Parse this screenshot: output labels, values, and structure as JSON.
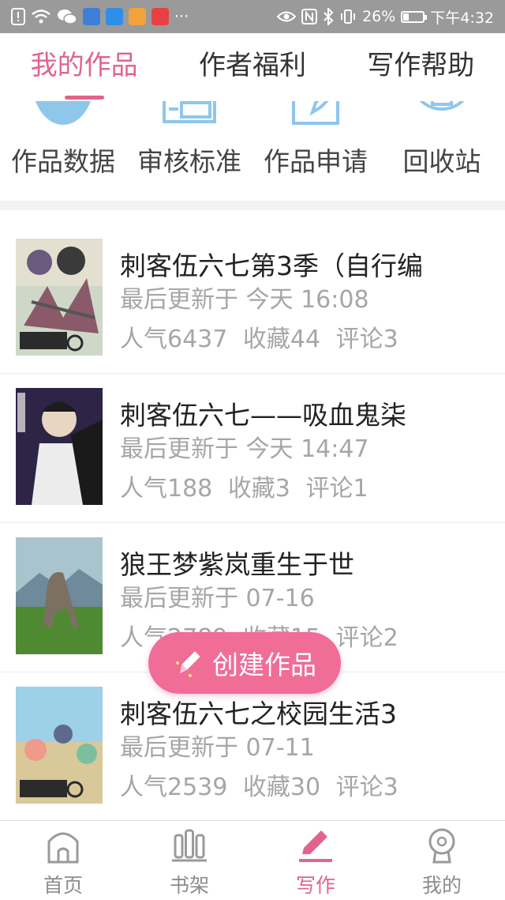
{
  "status_bar": {
    "battery": "26%",
    "battery_level": 0.26,
    "time": "下午4:32",
    "more_glyph": "···",
    "left_icons": [
      "alert-icon",
      "wifi-icon",
      "wechat-icon",
      "cloud-app-icon",
      "plane-app-icon",
      "game-app-icon",
      "store-app-icon",
      "more-icon"
    ],
    "right_icons": [
      "eye-icon",
      "nfc-icon",
      "bluetooth-icon",
      "vibrate-icon",
      "battery-icon"
    ]
  },
  "top_tabs": [
    {
      "label": "我的作品",
      "active": true
    },
    {
      "label": "作者福利",
      "active": false
    },
    {
      "label": "写作帮助",
      "active": false
    }
  ],
  "shortcuts": [
    {
      "label": "作品数据",
      "icon": "chart-icon"
    },
    {
      "label": "审核标准",
      "icon": "review-icon"
    },
    {
      "label": "作品申请",
      "icon": "edit-document-icon"
    },
    {
      "label": "回收站",
      "icon": "trash-icon"
    }
  ],
  "works": [
    {
      "title": "刺客伍六七第3季（自行编",
      "updated": "最后更新于 今天 16:08",
      "popularity": "人气6437",
      "favorites": "收藏44",
      "comments": "评论3"
    },
    {
      "title": "刺客伍六七——吸血鬼柒",
      "updated": "最后更新于 今天 14:47",
      "popularity": "人气188",
      "favorites": "收藏3",
      "comments": "评论1"
    },
    {
      "title": "狼王梦紫岚重生于世",
      "updated": "最后更新于 07-16",
      "popularity": "人气2789",
      "favorites": "收藏15",
      "comments": "评论2"
    },
    {
      "title": "刺客伍六七之校园生活3",
      "updated": "最后更新于 07-11",
      "popularity": "人气2539",
      "favorites": "收藏30",
      "comments": "评论3"
    }
  ],
  "create_button": {
    "label": "创建作品",
    "icon": "pencil-icon"
  },
  "bottom_nav": [
    {
      "label": "首页",
      "icon": "home-icon",
      "active": false
    },
    {
      "label": "书架",
      "icon": "bookshelf-icon",
      "active": false
    },
    {
      "label": "写作",
      "icon": "pen-icon",
      "active": true
    },
    {
      "label": "我的",
      "icon": "profile-icon",
      "active": false
    }
  ],
  "colors": {
    "accent": "#e2648d",
    "create_button": "#f06d98",
    "shortcut_icon": "#8ec7ea",
    "meta_text": "#a6a6a6",
    "status_bar": "#9a9a9a"
  }
}
